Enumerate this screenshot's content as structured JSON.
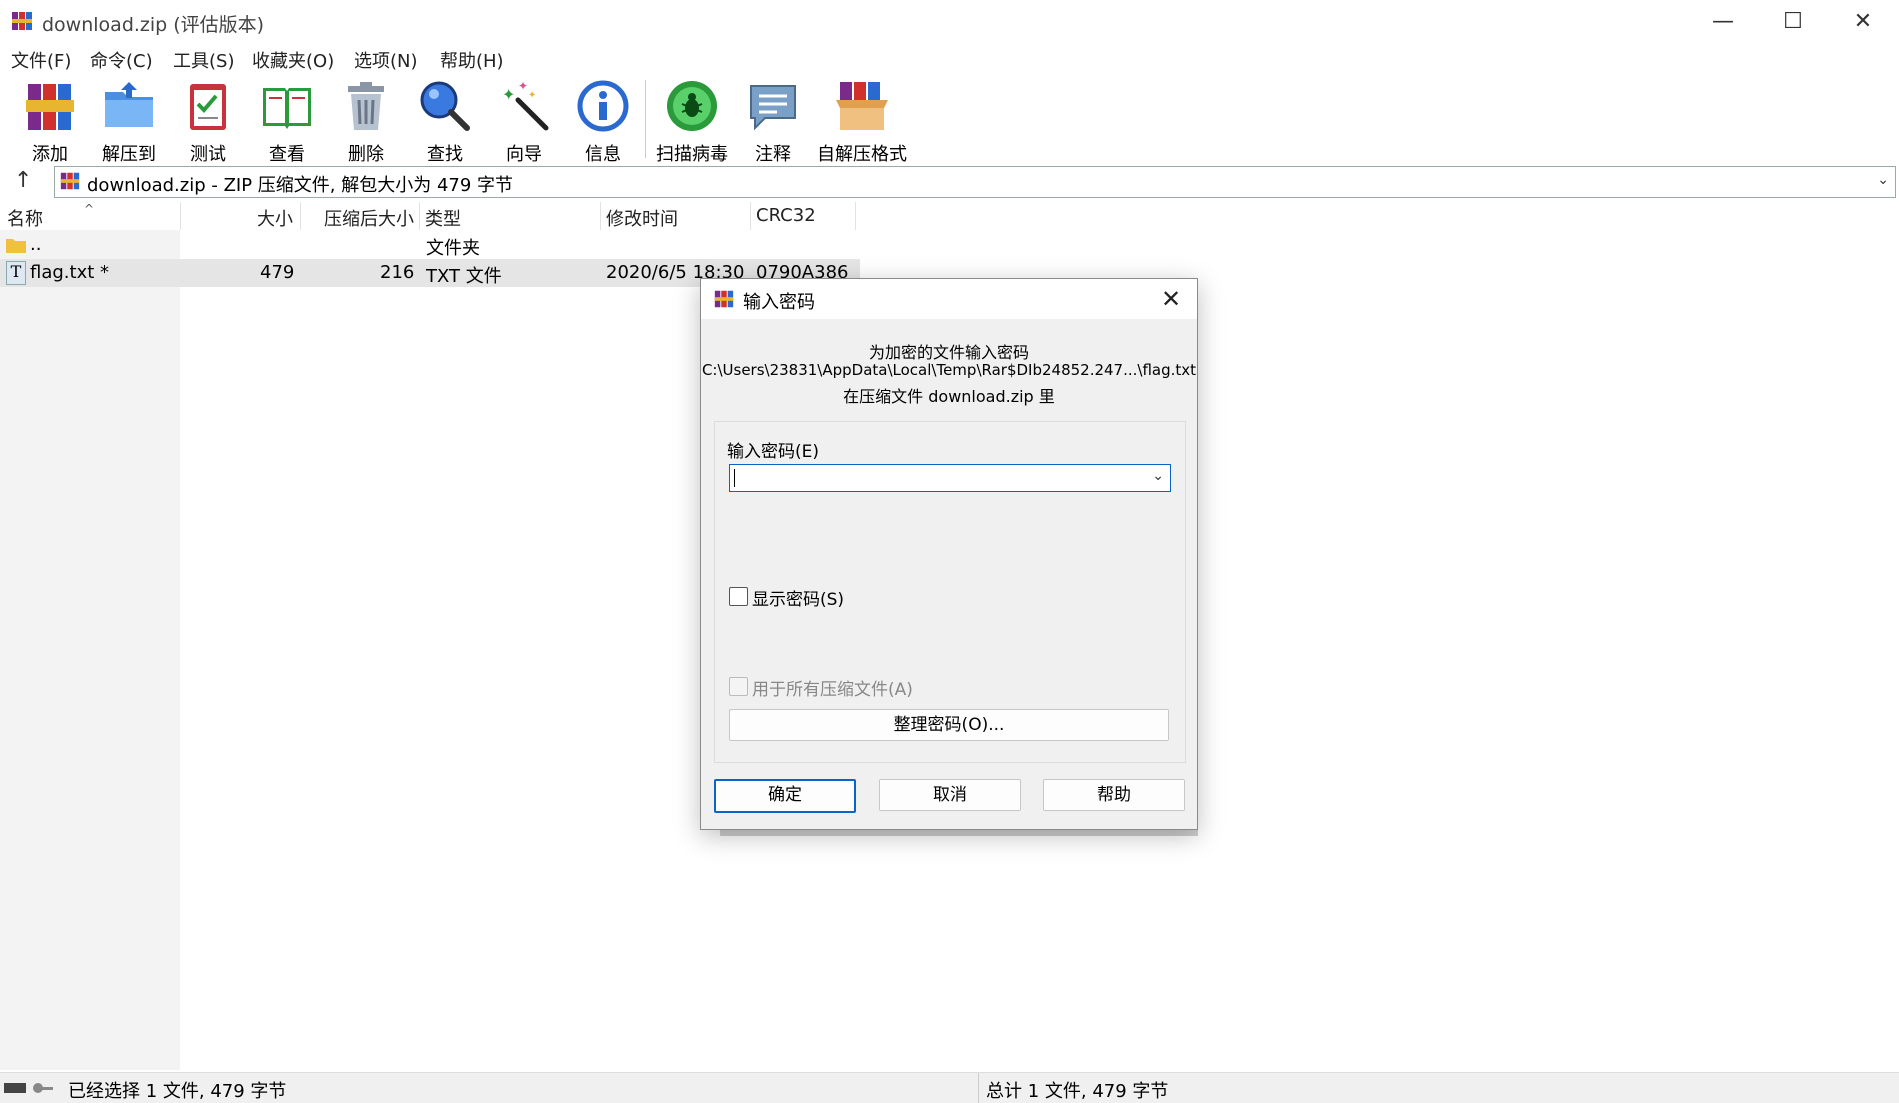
{
  "window": {
    "title": "download.zip (评估版本)"
  },
  "menu": [
    "文件(F)",
    "命令(C)",
    "工具(S)",
    "收藏夹(O)",
    "选项(N)",
    "帮助(H)"
  ],
  "toolbar": [
    {
      "label": "添加",
      "icon": "add-archive-icon"
    },
    {
      "label": "解压到",
      "icon": "extract-folder-icon"
    },
    {
      "label": "测试",
      "icon": "test-clipboard-icon"
    },
    {
      "label": "查看",
      "icon": "view-book-icon"
    },
    {
      "label": "删除",
      "icon": "delete-trash-icon"
    },
    {
      "label": "查找",
      "icon": "find-magnifier-icon"
    },
    {
      "label": "向导",
      "icon": "wizard-wand-icon"
    },
    {
      "label": "信息",
      "icon": "info-icon"
    },
    {
      "label": "扫描病毒",
      "icon": "virus-scan-icon"
    },
    {
      "label": "注释",
      "icon": "comment-icon"
    },
    {
      "label": "自解压格式",
      "icon": "sfx-box-icon"
    }
  ],
  "address": {
    "text": "download.zip - ZIP 压缩文件, 解包大小为 479 字节"
  },
  "columns": {
    "name": "名称",
    "size": "大小",
    "packed": "压缩后大小",
    "type": "类型",
    "modified": "修改时间",
    "crc": "CRC32"
  },
  "rows": [
    {
      "name": "..",
      "size": "",
      "packed": "",
      "type": "文件夹",
      "modified": "",
      "crc": ""
    },
    {
      "name": "flag.txt *",
      "size": "479",
      "packed": "216",
      "type": "TXT 文件",
      "modified": "2020/6/5 18:30",
      "crc": "0790A386"
    }
  ],
  "status": {
    "left": "已经选择 1 文件, 479 字节",
    "right": "总计 1 文件, 479 字节"
  },
  "dialog": {
    "title": "输入密码",
    "line1": "为加密的文件输入密码",
    "line2": "C:\\Users\\23831\\AppData\\Local\\Temp\\Rar$DIb24852.247...\\flag.txt",
    "line3": "在压缩文件 download.zip 里",
    "password_label": "输入密码(E)",
    "password_value": "",
    "show_password": "显示密码(S)",
    "use_all": "用于所有压缩文件(A)",
    "organize": "整理密码(O)...",
    "ok": "确定",
    "cancel": "取消",
    "help": "帮助"
  },
  "colors": {
    "accent": "#0a64c8",
    "selection": "#e5e5e5",
    "dialog_bg": "#f0f0f0"
  }
}
